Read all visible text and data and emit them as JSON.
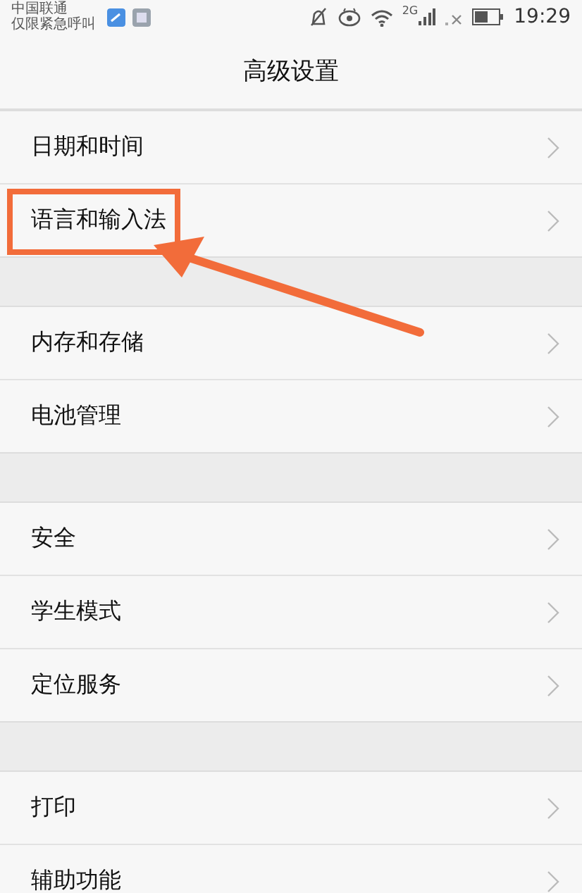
{
  "status_bar": {
    "carrier": "中国联通",
    "carrier_note": "仅限紧急呼叫",
    "network": "2G",
    "time": "19:29"
  },
  "title": "高级设置",
  "sections": [
    {
      "items": [
        {
          "label": "日期和时间",
          "highlighted": false
        },
        {
          "label": "语言和输入法",
          "highlighted": true
        }
      ]
    },
    {
      "items": [
        {
          "label": "内存和存储",
          "highlighted": false
        },
        {
          "label": "电池管理",
          "highlighted": false
        }
      ]
    },
    {
      "items": [
        {
          "label": "安全",
          "highlighted": false
        },
        {
          "label": "学生模式",
          "highlighted": false
        },
        {
          "label": "定位服务",
          "highlighted": false
        }
      ]
    },
    {
      "items": [
        {
          "label": "打印",
          "highlighted": false
        },
        {
          "label": "辅助功能",
          "highlighted": false
        }
      ]
    }
  ]
}
